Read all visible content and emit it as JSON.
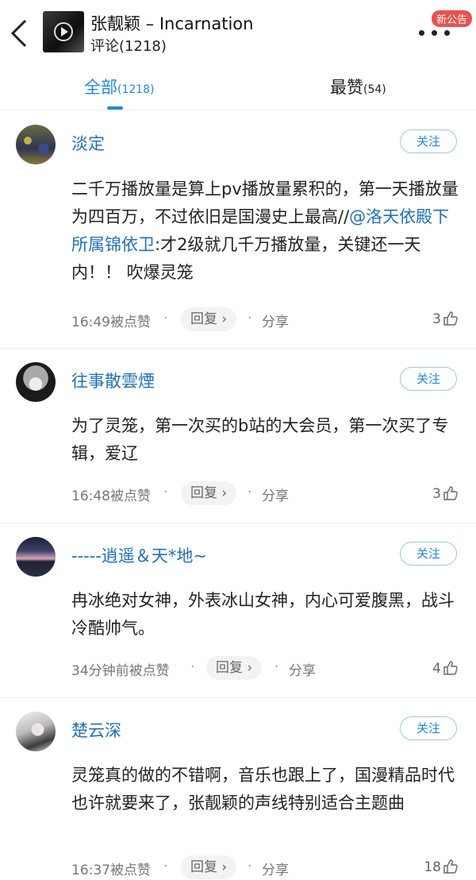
{
  "header": {
    "title": "张靓颖 – Incarnation",
    "subtitle": "评论(1218)",
    "badge": "新公告"
  },
  "tabs": {
    "all_label": "全部",
    "all_count": "(1218)",
    "top_label": "最赞",
    "top_count": "(54)"
  },
  "comments": [
    {
      "name": "淡定",
      "follow": "关注",
      "text_before": "二千万播放量是算上pv播放量累积的，第一天播放量为四百万，不过依旧是国漫史上最高//",
      "mention": "@洛天依殿下所属锦依卫",
      "text_after": ":才2级就几千万播放量，关键还一天内！！ 吹爆灵笼",
      "time": "16:49被点赞",
      "reply": "回复 ›",
      "share": "分享",
      "likes": "3"
    },
    {
      "name": "往事散雲煙",
      "follow": "关注",
      "text": "为了灵笼，第一次买的b站的大会员，第一次买了专辑，爱辽",
      "time": "16:48被点赞",
      "reply": "回复 ›",
      "share": "分享",
      "likes": "3"
    },
    {
      "name": "-----逍遥＆天*地~",
      "follow": "关注",
      "text": "冉冰绝对女神，外表冰山女神，内心可爱腹黑，战斗冷酷帅气。",
      "time": "34分钟前被点赞",
      "reply": "回复 ›",
      "share": "分享",
      "likes": "4"
    },
    {
      "name": "楚云深",
      "follow": "关注",
      "text": "灵笼真的做的不错啊，音乐也跟上了，国漫精品时代也许就要来了，张靓颖的声线特别适合主题曲",
      "time": "16:37被点赞",
      "reply": "回复 ›",
      "share": "分享",
      "likes": "18"
    }
  ],
  "colors": {
    "accent": "#1f8bd9",
    "username": "#1f72b8",
    "badge": "#e8534f"
  },
  "icons": [
    "back-arrow-icon",
    "play-icon",
    "more-dots-icon",
    "thumbs-up-icon"
  ]
}
